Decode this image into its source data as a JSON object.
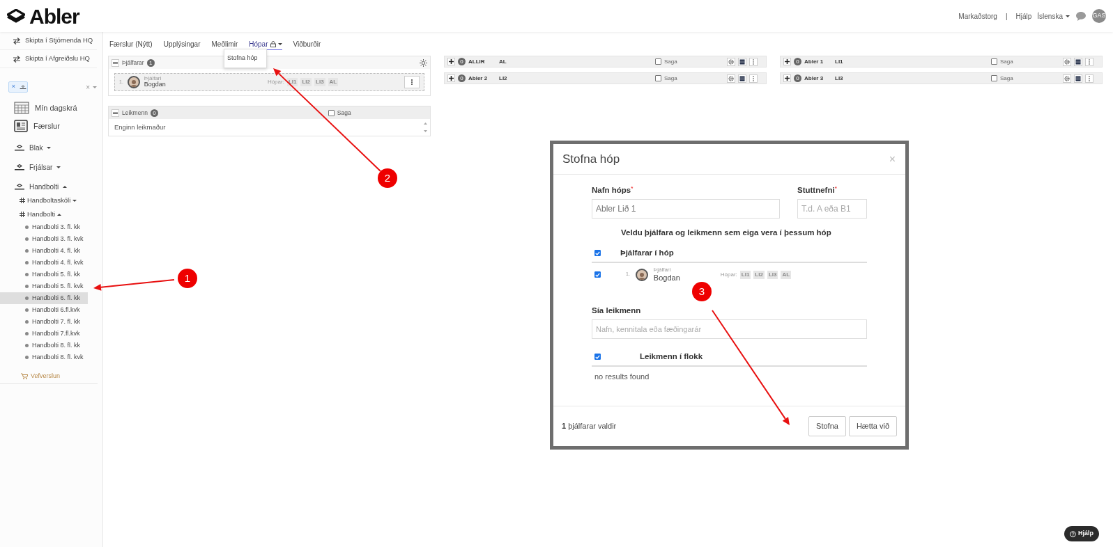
{
  "header": {
    "logo": "Abler",
    "links": [
      "Markaðstorg",
      "|",
      "Hjálp"
    ],
    "language": "Íslenska",
    "avatar": "GAS"
  },
  "sidebar": {
    "switch_links": [
      "Skipta í Stjórnenda HQ",
      "Skipta í Afgreiðslu HQ"
    ],
    "filter": {
      "chip_remove": "×",
      "clear": "×"
    },
    "nav": [
      {
        "kind": "calendar",
        "label": "Mín dagskrá"
      },
      {
        "kind": "news",
        "label": "Færslur"
      }
    ],
    "sports": [
      {
        "label": "Blak",
        "expanded": false
      },
      {
        "label": "Frjálsar",
        "expanded": false
      },
      {
        "label": "Handbolti",
        "expanded": true,
        "children": [
          {
            "label": "Handboltaskóli",
            "expanded": false
          },
          {
            "label": "Handbolti",
            "expanded": true,
            "children": [
              {
                "label": "Handbolti 3. fl. kk",
                "selected": false
              },
              {
                "label": "Handbolti 3. fl. kvk",
                "selected": false
              },
              {
                "label": "Handbolti 4. fl. kk",
                "selected": false
              },
              {
                "label": "Handbolti 4. fl. kvk",
                "selected": false
              },
              {
                "label": "Handbolti 5. fl. kk",
                "selected": false
              },
              {
                "label": "Handbolti 5. fl. kvk",
                "selected": false
              },
              {
                "label": "Handbolti 6. fl. kk",
                "selected": true
              },
              {
                "label": "Handbolti 6.fl.kvk",
                "selected": false
              },
              {
                "label": "Handbolti 7. fl. kk",
                "selected": false
              },
              {
                "label": "Handbolti 7.fl.kvk",
                "selected": false
              },
              {
                "label": "Handbolti 8. fl. kk",
                "selected": false
              },
              {
                "label": "Handbolti 8. fl. kvk",
                "selected": false
              }
            ]
          }
        ]
      }
    ],
    "shop": "Vefverslun"
  },
  "tabs": [
    {
      "label": "Færslur (Nýtt)",
      "selected": false,
      "locked": false
    },
    {
      "label": "Upplýsingar",
      "selected": false,
      "locked": false
    },
    {
      "label": "Meðlimir",
      "selected": false,
      "locked": false
    },
    {
      "label": "Hópar",
      "selected": true,
      "locked": true
    },
    {
      "label": "Viðburðir",
      "selected": false,
      "locked": false
    }
  ],
  "tab_menu": [
    "Stofna hóp"
  ],
  "coaches_panel": {
    "title": "Þjálfarar",
    "count": "1",
    "expanded": true,
    "members": [
      {
        "number": "1.",
        "role": "Þjálfari",
        "name": "Bogdan",
        "groups_label": "Hópar:",
        "groups": [
          "LI1",
          "LI2",
          "LI3",
          "AL"
        ]
      }
    ]
  },
  "players_panel": {
    "title": "Leikmenn",
    "count": "0",
    "expanded": true,
    "history_label": "Saga",
    "history_checked": false,
    "empty_text": "Enginn leikmaður"
  },
  "group_panels": [
    {
      "name": "ALLIR",
      "short": "AL",
      "count": "0",
      "expanded": false,
      "history_label": "Saga",
      "history_checked": false
    },
    {
      "name": "Abler 1",
      "short": "LI1",
      "count": "0",
      "expanded": false,
      "history_label": "Saga",
      "history_checked": false
    },
    {
      "name": "Abler 2",
      "short": "LI2",
      "count": "0",
      "expanded": false,
      "history_label": "Saga",
      "history_checked": false
    },
    {
      "name": "Abler 3",
      "short": "LI3",
      "count": "0",
      "expanded": false,
      "history_label": "Saga",
      "history_checked": false
    }
  ],
  "modal": {
    "title": "Stofna hóp",
    "close": "×",
    "name_label": "Nafn hóps",
    "name_value": "Abler Lið 1",
    "short_label": "Stuttnefni",
    "short_placeholder": "T.d. A eða B1",
    "required_mark": "*",
    "instructions": "Veldu þjálfara og leikmenn sem eiga vera í þessum hóp",
    "coaches_header": {
      "label": "Þjálfarar í hóp",
      "checked": true
    },
    "coaches": [
      {
        "checked": true,
        "number": "1.",
        "role": "Þjálfari",
        "name": "Bogdan",
        "groups_label": "Hópar:",
        "groups": [
          "LI1",
          "LI2",
          "LI3",
          "AL"
        ]
      }
    ],
    "filter_label": "Sía leikmenn",
    "filter_placeholder": "Nafn, kennitala eða fæðingarár",
    "players_header": {
      "label": "Leikmenn í flokk",
      "checked": true
    },
    "players_empty": "no results found",
    "footer_text": "**1** þjálfarar valdir",
    "buttons": [
      "Stofna",
      "Hætta við"
    ]
  },
  "annotations": [
    {
      "number": "1"
    },
    {
      "number": "2"
    },
    {
      "number": "3"
    }
  ],
  "help_button": "Hjálp"
}
